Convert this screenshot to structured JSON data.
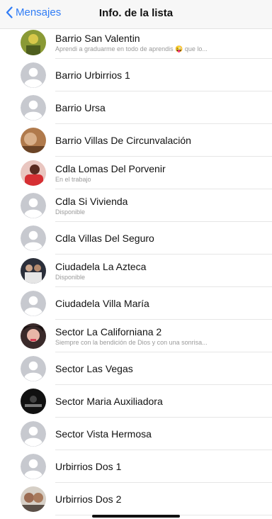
{
  "nav": {
    "back_label": "Mensajes",
    "title": "Info. de la lista"
  },
  "partial_row": {
    "status": "... ... ...",
    "emojis": "●●●●●"
  },
  "contacts": [
    {
      "name": "Barrio San Valentin",
      "status": "Aprendi a graduarme en todo de aprendis 😜 que lo...",
      "avatar": "photo-green"
    },
    {
      "name": "Barrio Urbirrios 1",
      "status": "",
      "avatar": "default"
    },
    {
      "name": "Barrio Ursa",
      "status": "",
      "avatar": "default"
    },
    {
      "name": "Barrio Villas De Circunvalación",
      "status": "",
      "avatar": "photo-brown"
    },
    {
      "name": "Cdla Lomas Del Porvenir",
      "status": "En el trabajo",
      "avatar": "photo-red"
    },
    {
      "name": "Cdla Si Vivienda",
      "status": "Disponible",
      "avatar": "default"
    },
    {
      "name": "Cdla Villas Del Seguro",
      "status": "",
      "avatar": "default"
    },
    {
      "name": "Ciudadela La Azteca",
      "status": "Disponible",
      "avatar": "photo-dark"
    },
    {
      "name": "Ciudadela Villa María",
      "status": "",
      "avatar": "default"
    },
    {
      "name": "Sector La Californiana 2",
      "status": "Siempre con la bendición de Dios y con una sonrisa...",
      "avatar": "photo-pink"
    },
    {
      "name": "Sector Las Vegas",
      "status": "",
      "avatar": "default"
    },
    {
      "name": "Sector Maria Auxiliadora",
      "status": "",
      "avatar": "photo-black"
    },
    {
      "name": "Sector Vista Hermosa",
      "status": "",
      "avatar": "default"
    },
    {
      "name": "Urbirrios Dos 1",
      "status": "",
      "avatar": "default"
    },
    {
      "name": "Urbirrios Dos 2",
      "status": "",
      "avatar": "photo-group"
    }
  ]
}
